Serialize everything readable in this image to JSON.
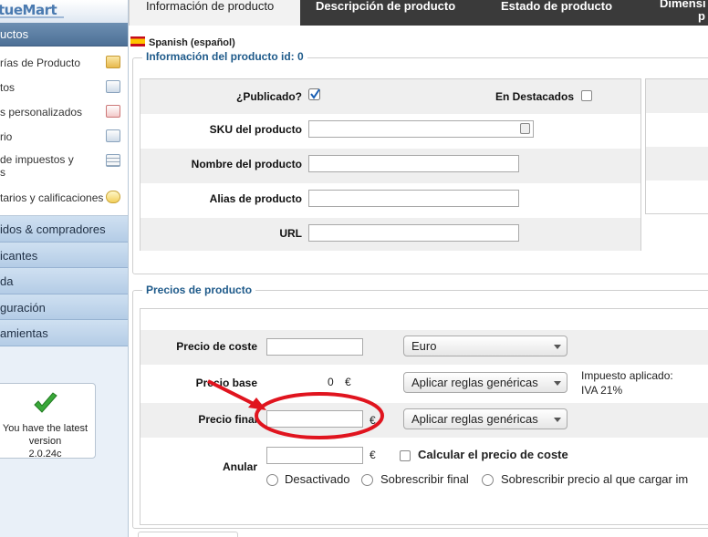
{
  "sidebar": {
    "logo_text": "tueMart",
    "active_section": "uctos",
    "sub_items": [
      {
        "label": "rías de Producto",
        "icon": "folder-icon"
      },
      {
        "label": "tos",
        "icon": "camera-icon"
      },
      {
        "label": "s personalizados",
        "icon": "custom-fields-icon"
      },
      {
        "label": "rio",
        "icon": "chart-icon"
      },
      {
        "label": "de impuestos y",
        "label2": "s",
        "icon": "calculator-icon"
      },
      {
        "label": "tarios y calificaciones",
        "icon": "comment-bubble-icon"
      }
    ],
    "categories": [
      "idos & compradores",
      "icantes",
      "da",
      "guración",
      "amientas"
    ],
    "version": {
      "line1": "You have the latest",
      "line2": "version",
      "line3": "2.0.24c"
    }
  },
  "tabs": [
    {
      "label": "Información de producto",
      "active": true
    },
    {
      "label": "Descripción de producto",
      "active": false
    },
    {
      "label": "Estado de producto",
      "active": false
    },
    {
      "label": "Dimensi",
      "label2": "p",
      "active": false
    }
  ],
  "product_info": {
    "language": "Spanish (español)",
    "legend": "Información del producto id: 0",
    "published_label": "¿Publicado?",
    "published_checked": true,
    "featured_label": "En Destacados",
    "featured_checked": false,
    "sku_label": "SKU del producto",
    "sku_value": "",
    "name_label": "Nombre del producto",
    "name_value": "",
    "alias_label": "Alias de producto",
    "alias_value": "",
    "url_label": "URL",
    "url_value": ""
  },
  "prices": {
    "legend": "Precios de producto",
    "cost_label": "Precio de coste",
    "cost_value": "",
    "currency_selected": "Euro",
    "base_label": "Precio base",
    "base_value": "0",
    "currency_symbol": "€",
    "base_rule": "Aplicar reglas genéricas",
    "tax_applied_label": "Impuesto aplicado:",
    "tax_applied_value": "IVA 21%",
    "final_label": "Precio final",
    "final_value": "",
    "final_rule": "Aplicar reglas genéricas",
    "override_label": "Anular",
    "override_value": "",
    "calc_cost_label": "Calcular el precio de coste",
    "radio_options": [
      "Desactivado",
      "Sobrescribir final",
      "Sobrescribir precio al que cargar im"
    ]
  },
  "colors": {
    "annotation": "#e0141e",
    "legend_text": "#1e5a8a",
    "tabbar_bg": "#3a3a3a"
  }
}
